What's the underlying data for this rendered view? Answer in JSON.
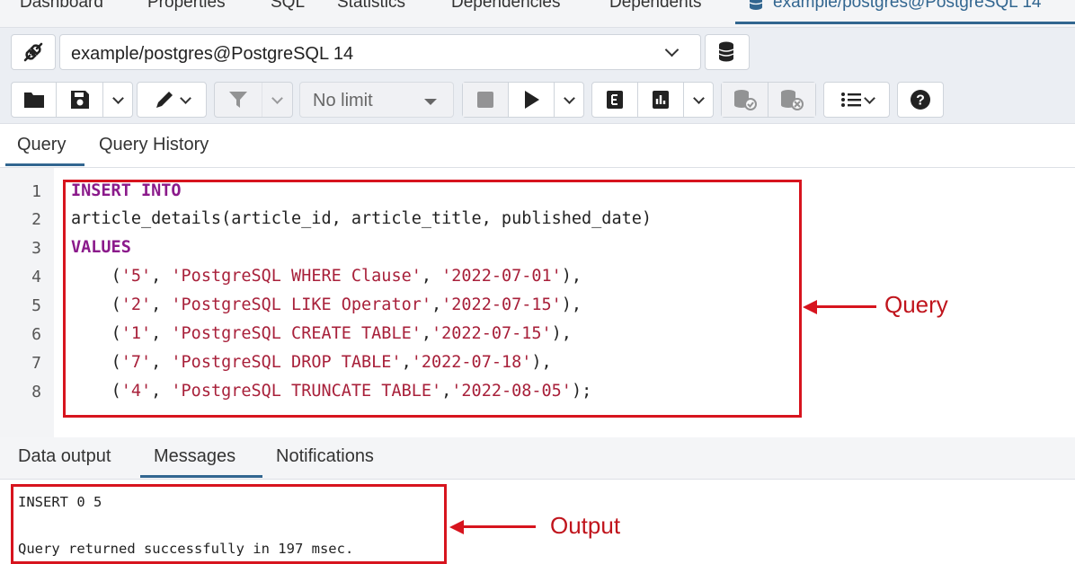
{
  "top_tabs": [
    "Dashboard",
    "Properties",
    "SQL",
    "Statistics",
    "Dependencies",
    "Dependents"
  ],
  "active_tab": "example/postgres@PostgreSQL 14",
  "connection": {
    "value": "example/postgres@PostgreSQL 14"
  },
  "toolbar": {
    "limit_value": "No limit"
  },
  "query_tabs": {
    "query": "Query",
    "history": "Query History"
  },
  "editor": {
    "line_numbers": [
      "1",
      "2",
      "3",
      "4",
      "5",
      "6",
      "7",
      "8"
    ],
    "lines": [
      {
        "kw": "INSERT INTO"
      },
      {
        "text": "article_details(article_id, article_title, published_date)"
      },
      {
        "kw": "VALUES"
      },
      {
        "indent": "    ",
        "p1": "(",
        "s1": "'5'",
        "p2": ", ",
        "s2": "'PostgreSQL WHERE Clause'",
        "p3": ", ",
        "s3": "'2022-07-01'",
        "p4": "),"
      },
      {
        "indent": "    ",
        "p1": "(",
        "s1": "'2'",
        "p2": ", ",
        "s2": "'PostgreSQL LIKE Operator'",
        "p3": ",",
        "s3": "'2022-07-15'",
        "p4": "),"
      },
      {
        "indent": "    ",
        "p1": "(",
        "s1": "'1'",
        "p2": ", ",
        "s2": "'PostgreSQL CREATE TABLE'",
        "p3": ",",
        "s3": "'2022-07-15'",
        "p4": "),"
      },
      {
        "indent": "    ",
        "p1": "(",
        "s1": "'7'",
        "p2": ", ",
        "s2": "'PostgreSQL DROP TABLE'",
        "p3": ",",
        "s3": "'2022-07-18'",
        "p4": "),"
      },
      {
        "indent": "    ",
        "p1": "(",
        "s1": "'4'",
        "p2": ", ",
        "s2": "'PostgreSQL TRUNCATE TABLE'",
        "p3": ",",
        "s3": "'2022-08-05'",
        "p4": ");"
      }
    ]
  },
  "annotations": {
    "query": "Query",
    "output": "Output"
  },
  "bottom_tabs": {
    "data_output": "Data output",
    "messages": "Messages",
    "notifications": "Notifications"
  },
  "messages": {
    "line1": "INSERT 0 5",
    "line2": "Query returned successfully in 197 msec."
  },
  "colors": {
    "accent": "#326690",
    "highlight": "#d7141e",
    "keyword": "#8b1a8b",
    "string": "#a8203a"
  }
}
